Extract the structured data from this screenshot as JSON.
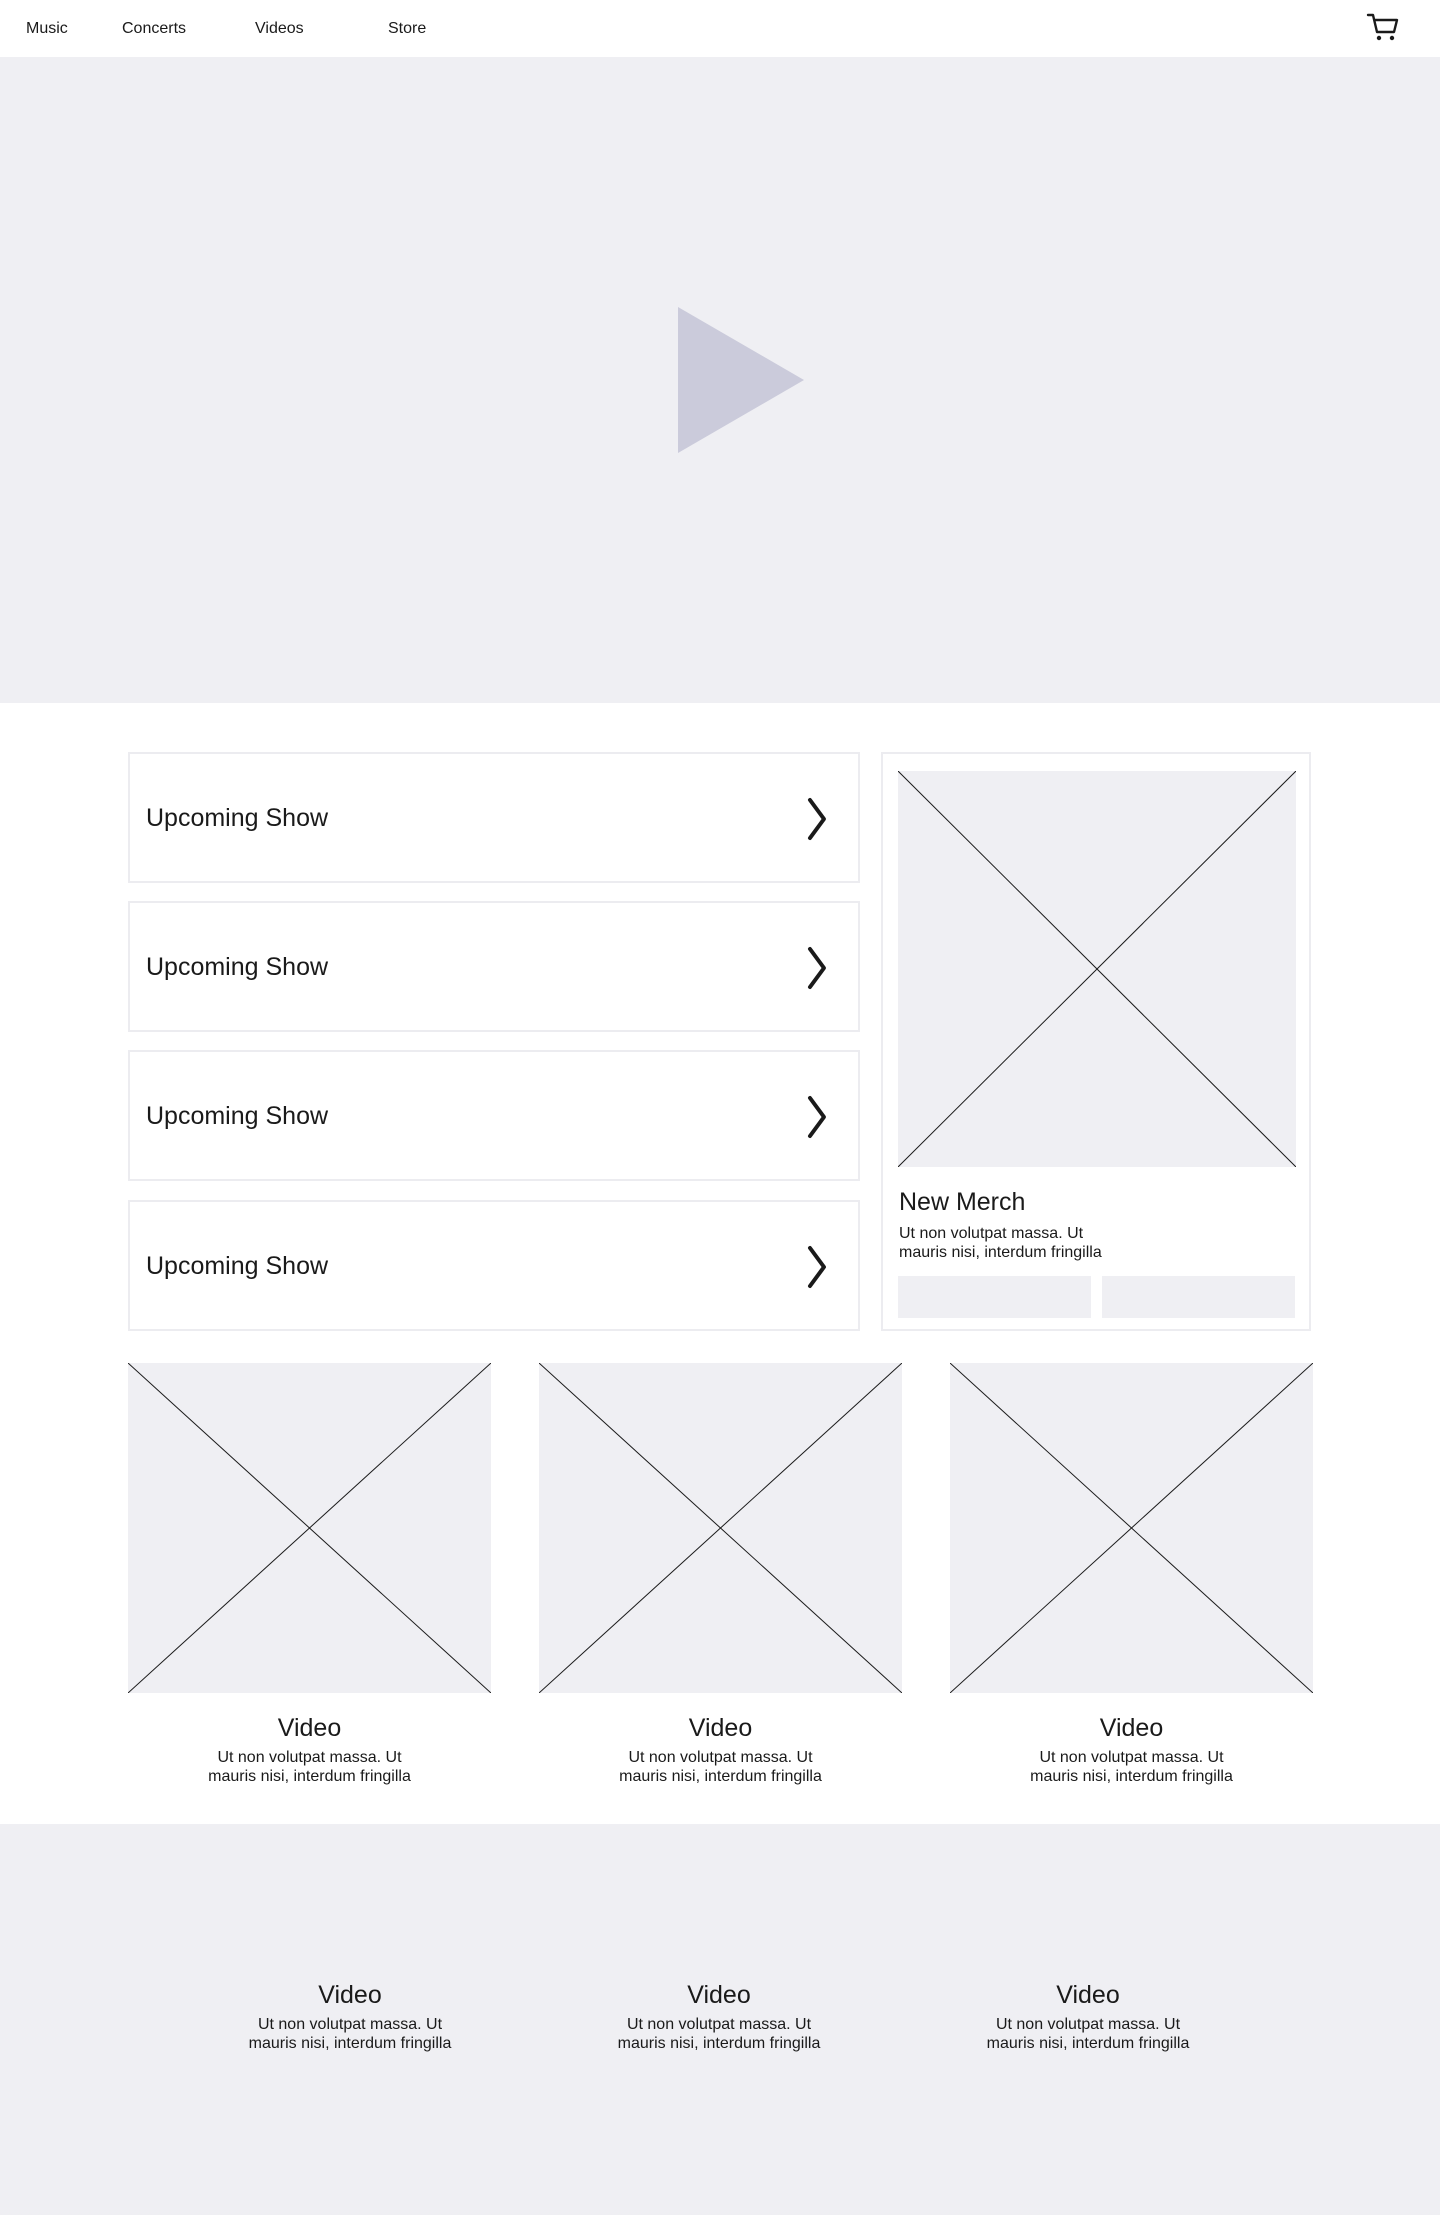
{
  "nav": {
    "items": [
      {
        "label": "Music"
      },
      {
        "label": "Concerts"
      },
      {
        "label": "Videos"
      },
      {
        "label": "Store"
      }
    ],
    "cart_icon": "cart-icon"
  },
  "hero": {
    "play_icon": "play-icon"
  },
  "shows": [
    {
      "label": "Upcoming Show"
    },
    {
      "label": "Upcoming Show"
    },
    {
      "label": "Upcoming Show"
    },
    {
      "label": "Upcoming Show"
    }
  ],
  "merch": {
    "title": "New Merch",
    "desc_line1": "Ut non volutpat massa. Ut",
    "desc_line2": "mauris nisi, interdum fringilla"
  },
  "videos": [
    {
      "title": "Video",
      "desc_line1": "Ut non volutpat massa. Ut",
      "desc_line2": "mauris nisi, interdum fringilla"
    },
    {
      "title": "Video",
      "desc_line1": "Ut non volutpat massa. Ut",
      "desc_line2": "mauris nisi, interdum fringilla"
    },
    {
      "title": "Video",
      "desc_line1": "Ut non volutpat massa. Ut",
      "desc_line2": "mauris nisi, interdum fringilla"
    }
  ],
  "bottom_videos": [
    {
      "title": "Video",
      "desc_line1": "Ut non volutpat massa. Ut",
      "desc_line2": "mauris nisi, interdum fringilla"
    },
    {
      "title": "Video",
      "desc_line1": "Ut non volutpat massa. Ut",
      "desc_line2": "mauris nisi, interdum fringilla"
    },
    {
      "title": "Video",
      "desc_line1": "Ut non volutpat massa. Ut",
      "desc_line2": "mauris nisi, interdum fringilla"
    }
  ],
  "colors": {
    "placeholder_bg": "#efeff3",
    "play_icon": "#cbcbdb",
    "border": "#ececf0",
    "text": "#1a1a1a"
  }
}
